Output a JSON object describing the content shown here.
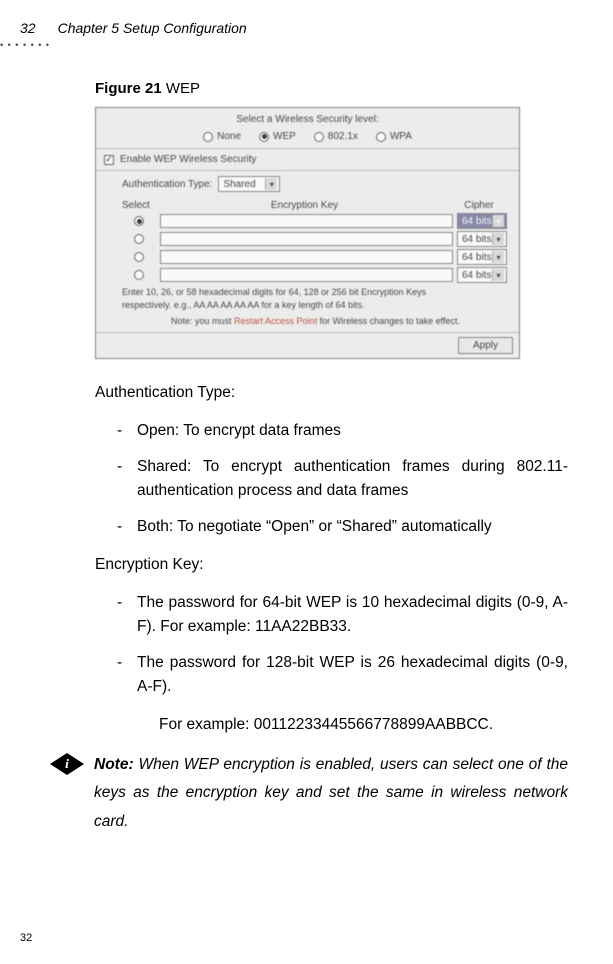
{
  "header": {
    "page_num": "32",
    "chapter": "Chapter 5 Setup Configuration"
  },
  "figure": {
    "caption_label": "Figure 21",
    "caption_text": "WEP",
    "panel": {
      "security_header": "Select a Wireless Security level:",
      "opts": {
        "none": "None",
        "wep": "WEP",
        "dot1x": "802.1x",
        "wpa": "WPA"
      },
      "enable_label": "Enable WEP Wireless Security",
      "auth_label": "Authentication Type:",
      "auth_value": "Shared",
      "tbl": {
        "select": "Select",
        "enc": "Encryption Key",
        "cipher": "Cipher"
      },
      "cipher_value": "64 bits",
      "hint1": "Enter 10, 26, or 58 hexadecimal digits for 64, 128 or 256 bit Encryption Keys",
      "hint2": "respectively. e.g., AA AA AA AA AA for a key length of 64 bits.",
      "note_pre": "Note: you must ",
      "note_red": "Restart Access Point",
      "note_post": " for Wireless changes to take effect.",
      "apply": "Apply"
    }
  },
  "body": {
    "auth_heading": "Authentication Type:",
    "auth_items": [
      "Open: To encrypt data frames",
      "Shared: To encrypt authentication frames during 802.11-authentication process and data frames",
      "Both: To negotiate “Open” or “Shared” automatically"
    ],
    "enc_heading": "Encryption Key:",
    "enc_items": [
      "The password for 64-bit WEP is 10 hexadecimal digits (0-9, A-F). For example: 11AA22BB33.",
      "The password for 128-bit WEP is 26 hexadecimal digits (0-9, A-F)."
    ],
    "enc_example": "For example: 00112233445566778899AABBCC."
  },
  "note": {
    "label": "Note:",
    "text": " When WEP encryption is enabled, users can select one of the keys as the encryption key and set the same in wireless network card."
  },
  "footer_page": "32"
}
